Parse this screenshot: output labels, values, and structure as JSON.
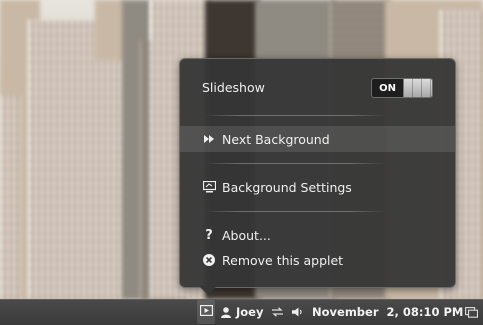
{
  "menu": {
    "slideshow_label": "Slideshow",
    "toggle_state": "ON",
    "next_background": "Next Background",
    "background_settings": "Background Settings",
    "about": "About...",
    "remove_applet": "Remove this applet"
  },
  "panel": {
    "user_name": "Joey",
    "clock": "November  2, 08:10 PM"
  },
  "icons": {
    "slideshow_applet": "slideshow-applet-icon",
    "user": "user-icon",
    "network": "network-icon",
    "volume": "volume-icon",
    "show_desktop": "show-desktop-icon"
  }
}
